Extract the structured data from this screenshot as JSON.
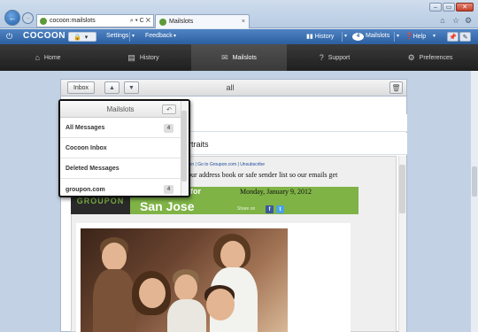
{
  "browser": {
    "address": "cocoon:mailslots",
    "address_icons": "⌕ ▾ C ✕",
    "tab_label": "Mailslots",
    "tab_close": "×",
    "win_min": "–",
    "win_max": "▭",
    "win_close": "✕",
    "home_icon": "⌂",
    "star_icon": "☆",
    "gear_icon": "⚙"
  },
  "toolbar": {
    "brand": "COCOON",
    "settings": "Settings",
    "feedback": "Feedback",
    "history": "History",
    "mailslots_count": "4",
    "mailslots": "Mailslots",
    "help": "Help"
  },
  "nav": {
    "items": [
      {
        "label": "Home",
        "icon": "⌂"
      },
      {
        "label": "History",
        "icon": "▤"
      },
      {
        "label": "Mailslots",
        "icon": "✉"
      },
      {
        "label": "Support",
        "icon": "?"
      },
      {
        "label": "Preferences",
        "icon": "⚙"
      }
    ]
  },
  "folderbar": {
    "inbox": "Inbox",
    "up": "▲",
    "down": "▼",
    "title": "all",
    "trash": "🗑"
  },
  "dropdown": {
    "title": "Mailslots",
    "refresh": "↶",
    "items": [
      {
        "label": "All Messages",
        "count": "4"
      },
      {
        "label": "Cocoon Inbox",
        "count": ""
      },
      {
        "label": "Deleted Messages",
        "count": ""
      },
      {
        "label": "groupon.com",
        "count": "4"
      }
    ]
  },
  "email": {
    "subject": "rtraits",
    "preheader": "upon  |  Go to Groupon.com  |  Unsubscribe",
    "address_notice": "your address book or safe sender list so our emails get",
    "banner_logo": "GROUPON",
    "banner_for": "for",
    "banner_date": "Monday, January 9, 2012",
    "banner_city": "San Jose",
    "banner_share": "Share on"
  }
}
